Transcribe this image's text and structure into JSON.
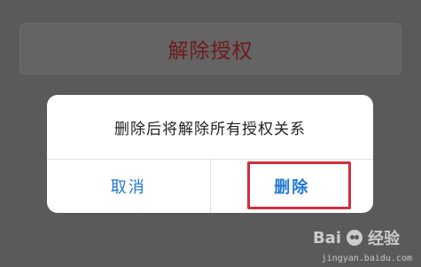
{
  "background": {
    "revoke_button_label": "解除授权"
  },
  "dialog": {
    "message": "删除后将解除所有授权关系",
    "cancel_label": "取消",
    "delete_label": "删除"
  },
  "watermark": {
    "brand_left": "Bai",
    "brand_right": "经验",
    "url": "jingyan.baidu.com"
  },
  "colors": {
    "overlay": "#5a5a5a",
    "revoke_text": "#6f1a1c",
    "action_blue": "#1f78d1",
    "highlight_red": "#d0303e"
  },
  "icons": {
    "watermark_logo": "paw-icon"
  }
}
